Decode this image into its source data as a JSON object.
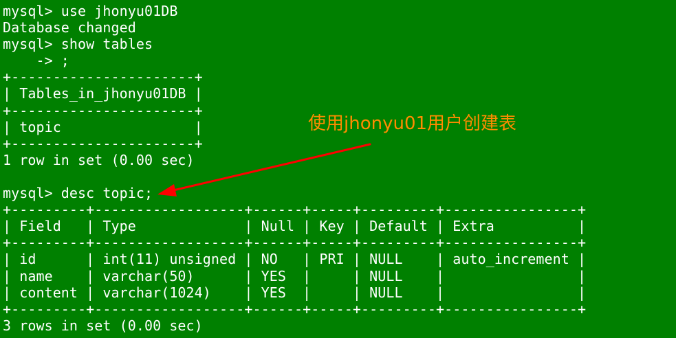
{
  "terminal": {
    "lines": [
      "mysql> use jhonyu01DB",
      "Database changed",
      "mysql> show tables",
      "    -> ;",
      "+----------------------+",
      "| Tables_in_jhonyu01DB |",
      "+----------------------+",
      "| topic                |",
      "+----------------------+",
      "1 row in set (0.00 sec)",
      "",
      "mysql> desc topic;",
      "+---------+------------------+------+-----+---------+----------------+",
      "| Field   | Type             | Null | Key | Default | Extra          |",
      "+---------+------------------+------+-----+---------+----------------+",
      "| id      | int(11) unsigned | NO   | PRI | NULL    | auto_increment |",
      "| name    | varchar(50)      | YES  |     | NULL    |                |",
      "| content | varchar(1024)    | YES  |     | NULL    |                |",
      "+---------+------------------+------+-----+---------+----------------+",
      "3 rows in set (0.00 sec)"
    ]
  },
  "annotation": {
    "text": "使用jhonyu01用户创建表",
    "text_color": "#ff8c00",
    "arrow_color": "#ff0000"
  },
  "colors": {
    "background": "#008000",
    "foreground": "#ffffff"
  }
}
